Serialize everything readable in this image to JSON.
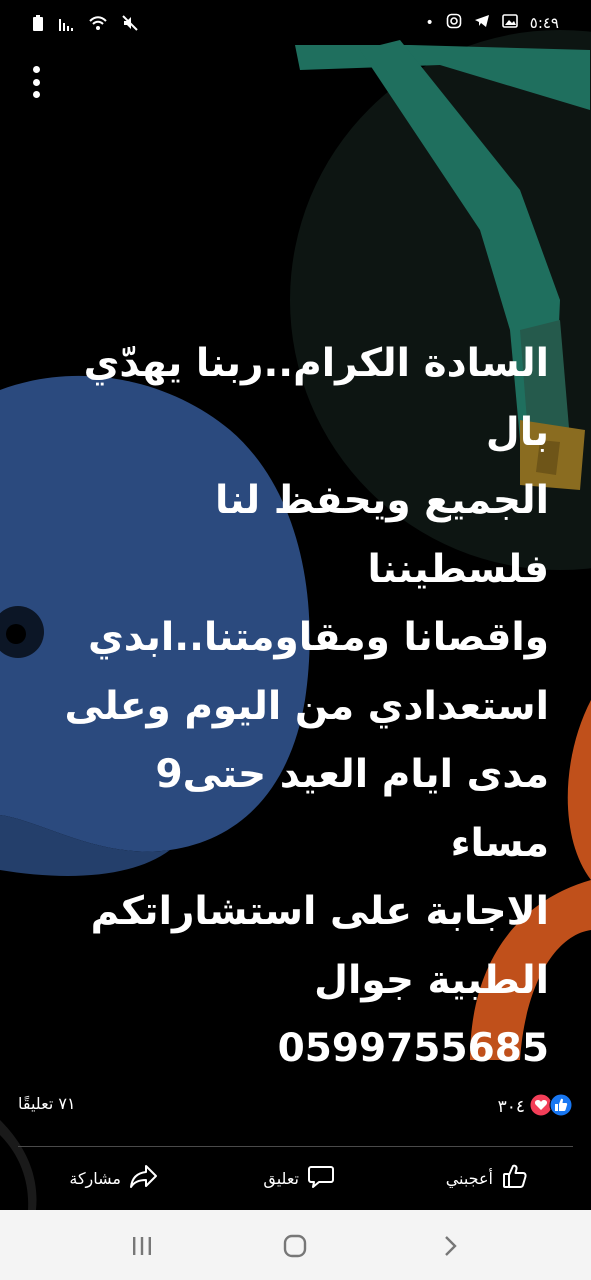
{
  "status_bar": {
    "time": "٥:٤٩",
    "dot": "•",
    "icons_right": [
      "gallery-icon",
      "telegram-icon",
      "instagram-icon"
    ],
    "icons_left": [
      "mute-icon",
      "wifi-icon",
      "signal-icon",
      "battery-icon"
    ]
  },
  "post": {
    "text": "السادة الكرام..ربنا يهدّي بال\nالجميع ويحفظ لنا فلسطيننا\nواقصانا ومقاومتنا..ابدي\nاستعدادي من اليوم وعلى\nمدى ايام العيد حتى9 مساء\nالاجابة على استشاراتكم\nالطبية جوال\n0599755685"
  },
  "reactions": {
    "count": "٣٠٤",
    "comments": "٧١ تعليقًا",
    "types": [
      "like",
      "love"
    ]
  },
  "actions": {
    "like_label": "أعجبني",
    "comment_label": "تعليق",
    "share_label": "مشاركة"
  },
  "colors": {
    "background": "#000000",
    "blue_shape": "#2b4a7e",
    "teal_shape": "#1f6f5e",
    "orange_shape": "#c0501b",
    "facebook_blue": "#1877f2",
    "love_red": "#f33e58"
  }
}
